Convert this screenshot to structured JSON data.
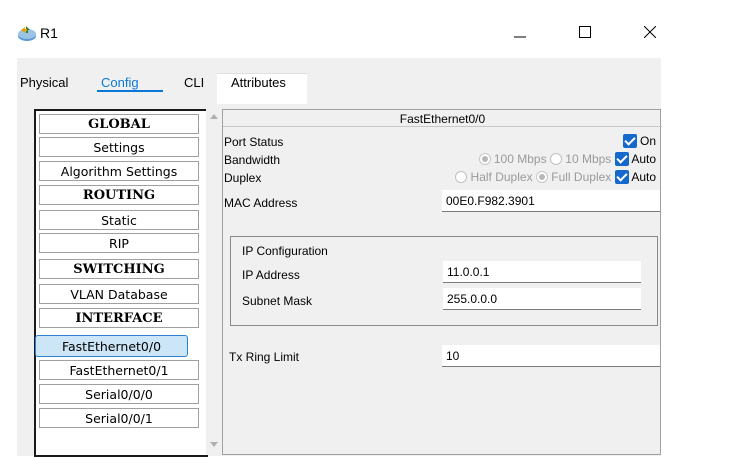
{
  "window": {
    "title": "R1"
  },
  "tabs": [
    {
      "label": "Physical"
    },
    {
      "label": "Config"
    },
    {
      "label": "CLI"
    },
    {
      "label": "Attributes"
    }
  ],
  "nav": {
    "items": [
      {
        "label": "GLOBAL",
        "type": "header"
      },
      {
        "label": "Settings"
      },
      {
        "label": "Algorithm Settings"
      },
      {
        "label": "ROUTING",
        "type": "header"
      },
      {
        "label": "Static"
      },
      {
        "label": "RIP"
      },
      {
        "label": "SWITCHING",
        "type": "header"
      },
      {
        "label": "VLAN Database"
      },
      {
        "label": "INTERFACE",
        "type": "header"
      },
      {
        "label": "FastEthernet0/0",
        "selected": true
      },
      {
        "label": "FastEthernet0/1"
      },
      {
        "label": "Serial0/0/0"
      },
      {
        "label": "Serial0/0/1"
      }
    ]
  },
  "interface": {
    "name": "FastEthernet0/0",
    "port_status": {
      "label": "Port Status",
      "on_label": "On",
      "checked": true
    },
    "bandwidth": {
      "label": "Bandwidth",
      "opt1": "100 Mbps",
      "opt2": "10 Mbps",
      "auto_label": "Auto"
    },
    "duplex": {
      "label": "Duplex",
      "opt1": "Half Duplex",
      "opt2": "Full Duplex",
      "auto_label": "Auto"
    },
    "mac": {
      "label": "MAC Address",
      "value": "00E0.F982.3901"
    },
    "ip_config": {
      "title": "IP Configuration",
      "ip_label": "IP Address",
      "ip_value": "11.0.0.1",
      "mask_label": "Subnet Mask",
      "mask_value": "255.0.0.0"
    },
    "tx_ring": {
      "label": "Tx Ring Limit",
      "value": "10"
    }
  },
  "colors": {
    "accent": "#0a78d7",
    "checkbox": "#1669cc",
    "selected_bg": "#cde6f7"
  }
}
